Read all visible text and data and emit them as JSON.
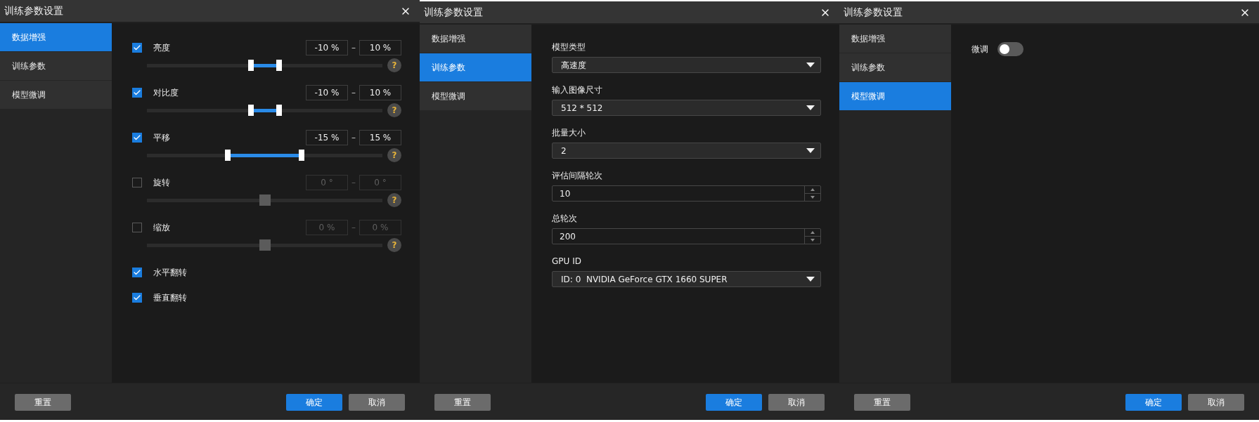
{
  "dialogs": [
    {
      "title": "训练参数设置",
      "sidebar": {
        "items": [
          {
            "label": "数据增强",
            "selected": true
          },
          {
            "label": "训练参数",
            "selected": false
          },
          {
            "label": "模型微调",
            "selected": false
          }
        ]
      },
      "content": {
        "items": [
          {
            "kind": "range",
            "label": "亮度",
            "checked": true,
            "min": "-10 %",
            "separator": "–",
            "max": "10 %",
            "thumbs": [
              {
                "level": 0.442
              },
              {
                "level": 0.561
              }
            ],
            "help": "?"
          },
          {
            "kind": "range",
            "label": "对比度",
            "checked": true,
            "min": "-10 %",
            "separator": "–",
            "max": "10 %",
            "thumbs": [
              {
                "level": 0.442
              },
              {
                "level": 0.561
              }
            ],
            "help": "?"
          },
          {
            "kind": "range",
            "label": "平移",
            "checked": true,
            "min": "-15 %",
            "separator": "–",
            "max": "15 %",
            "thumbs": [
              {
                "level": 0.344
              },
              {
                "level": 0.656
              }
            ],
            "help": "?"
          },
          {
            "kind": "range",
            "label": "旋转",
            "checked": false,
            "min": "0 °",
            "separator": "–",
            "max": "0 °",
            "thumbs": [
              {
                "level": 0.5
              }
            ],
            "help": "?"
          },
          {
            "kind": "range",
            "label": "缩放",
            "checked": false,
            "min": "0 %",
            "separator": "–",
            "max": "0 %",
            "thumbs": [
              {
                "level": 0.5
              }
            ],
            "help": "?"
          },
          {
            "kind": "check",
            "label": "水平翻转",
            "checked": true
          },
          {
            "kind": "check",
            "label": "垂直翻转",
            "checked": true
          }
        ]
      },
      "footer": {
        "start": [
          {
            "label": "重置",
            "kind": "secondary"
          }
        ],
        "end": [
          {
            "label": "确定",
            "kind": "primary"
          },
          {
            "label": "取消",
            "kind": "secondary"
          }
        ]
      }
    },
    {
      "title": "训练参数设置",
      "sidebar": {
        "items": [
          {
            "label": "数据增强",
            "selected": false
          },
          {
            "label": "训练参数",
            "selected": true
          },
          {
            "label": "模型微调",
            "selected": false
          }
        ]
      },
      "content": {
        "items": [
          {
            "kind": "select",
            "label": "模型类型",
            "value": "高速度"
          },
          {
            "kind": "select",
            "label": "输入图像尺寸",
            "value": "512 * 512"
          },
          {
            "kind": "select",
            "label": "批量大小",
            "value": "2"
          },
          {
            "kind": "number",
            "label": "评估间隔轮次",
            "value": "10"
          },
          {
            "kind": "number",
            "label": "总轮次",
            "value": "200"
          },
          {
            "kind": "select",
            "label": "GPU ID",
            "value": "ID: 0  NVIDIA GeForce GTX 1660 SUPER"
          }
        ]
      },
      "footer": {
        "start": [
          {
            "label": "重置",
            "kind": "secondary"
          }
        ],
        "end": [
          {
            "label": "确定",
            "kind": "primary"
          },
          {
            "label": "取消",
            "kind": "secondary"
          }
        ]
      }
    },
    {
      "title": "训练参数设置",
      "sidebar": {
        "items": [
          {
            "label": "数据增强",
            "selected": false
          },
          {
            "label": "训练参数",
            "selected": false
          },
          {
            "label": "模型微调",
            "selected": true
          }
        ]
      },
      "content": {
        "items": [
          {
            "kind": "switch",
            "label": "微调",
            "on": false
          }
        ]
      },
      "footer": {
        "start": [
          {
            "label": "重置",
            "kind": "secondary"
          }
        ],
        "end": [
          {
            "label": "确定",
            "kind": "primary"
          },
          {
            "label": "取消",
            "kind": "secondary"
          }
        ]
      }
    }
  ]
}
